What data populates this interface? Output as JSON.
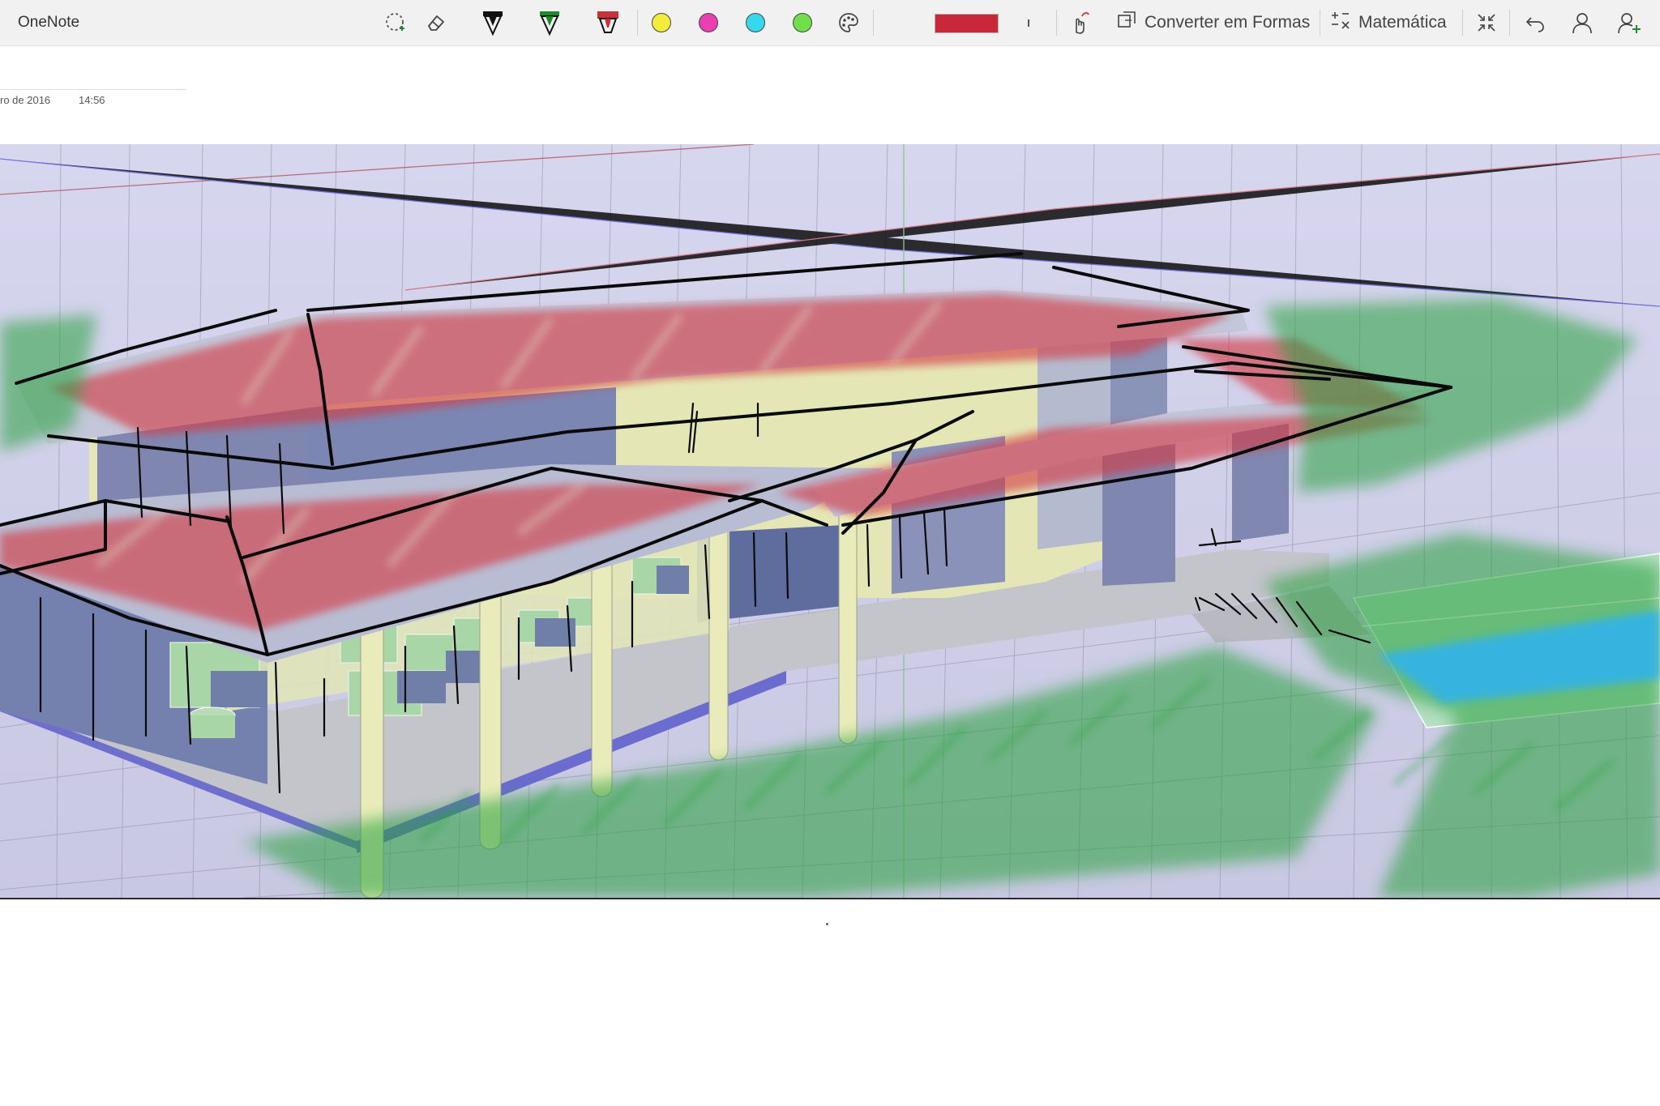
{
  "app": {
    "title": "OneNote"
  },
  "toolbar": {
    "lasso_icon": "lasso-select-icon",
    "eraser_icon": "eraser-icon",
    "pens": [
      {
        "name": "black-pen",
        "color": "#111111"
      },
      {
        "name": "green-pen",
        "color": "#1d8a2e"
      },
      {
        "name": "red-highlighter",
        "color": "#c8313a"
      }
    ],
    "swatches": [
      {
        "name": "yellow",
        "color": "#f4ec3b"
      },
      {
        "name": "magenta",
        "color": "#ea3fb3"
      },
      {
        "name": "cyan",
        "color": "#38d8ec"
      },
      {
        "name": "green",
        "color": "#6fe04a"
      }
    ],
    "palette_icon": "color-palette-icon",
    "current_color": "#c8283a",
    "touch_draw_icon": "touch-draw-icon",
    "convert_shapes_label": "Converter em Formas",
    "math_label": "Matemática",
    "collapse_icon": "collapse-icon",
    "undo_icon": "undo-icon",
    "user_icon": "user-icon",
    "add_user_icon": "add-user-icon"
  },
  "page": {
    "date": "ro de 2016",
    "time": "14:56"
  },
  "canvas": {
    "description_colors": {
      "sky": "#d3d2ec",
      "roof_ink": "#d43a44",
      "grass_ink": "#27a13a",
      "water_ink": "#2fb2f0",
      "wall_yellow": "#e4e7b5",
      "wall_blue": "#7581ab",
      "floor": "#c9c9cf",
      "sketch_line": "#0a0a0a"
    }
  }
}
